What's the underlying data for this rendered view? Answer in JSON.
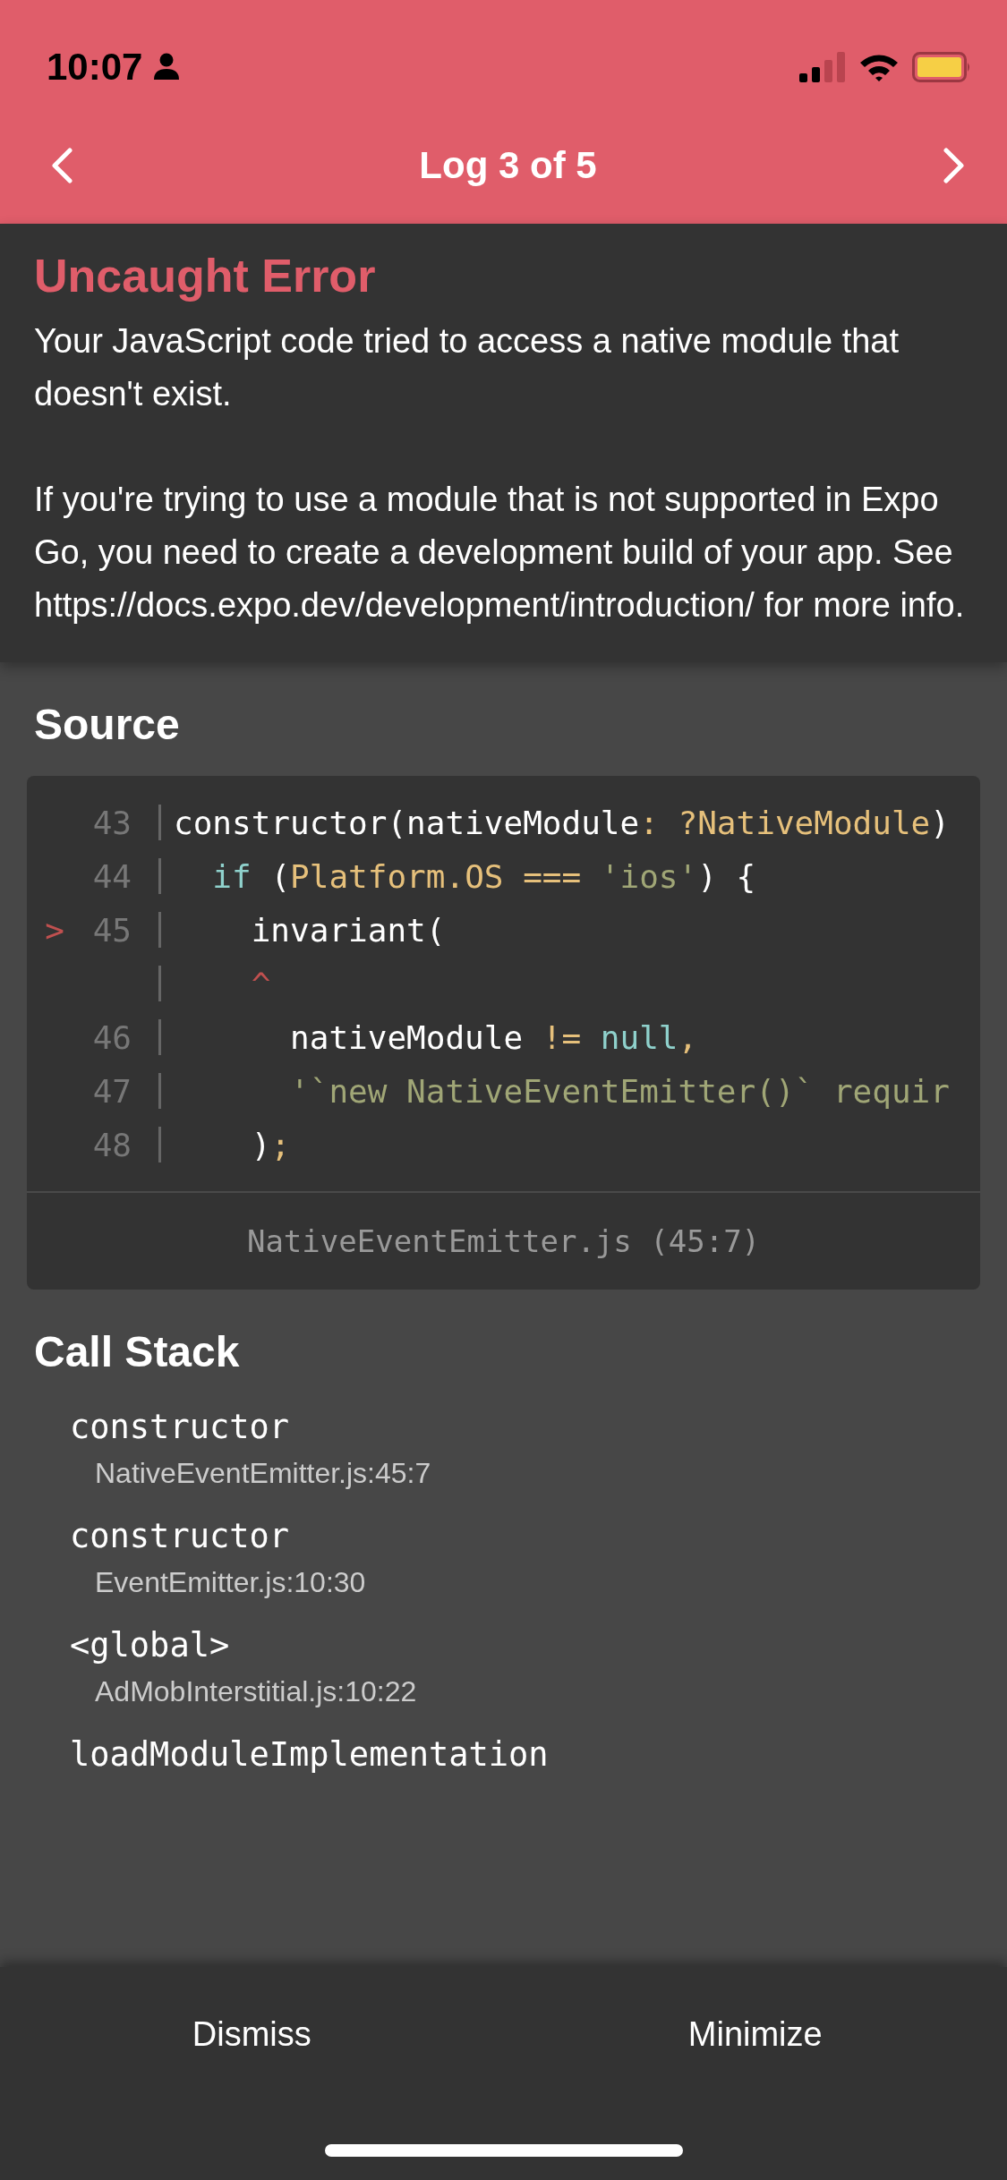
{
  "status_bar": {
    "time": "10:07"
  },
  "header": {
    "title": "Log 3 of 5"
  },
  "error": {
    "title": "Uncaught Error",
    "paragraphs": [
      "Your JavaScript code tried to access a native module that doesn't exist.",
      "If you're trying to use a module that is not supported in Expo Go, you need to create a development build of your app. See https://docs.expo.dev/development/introduction/ for more info."
    ]
  },
  "source": {
    "title": "Source",
    "lines": [
      {
        "number": "43",
        "tokens": [
          {
            "text": "constructor(nativeModule",
            "kind": "plain"
          },
          {
            "text": ": ?NativeModule",
            "kind": "type"
          },
          {
            "text": ")",
            "kind": "plain"
          }
        ]
      },
      {
        "number": "44",
        "tokens": [
          {
            "text": "  if",
            "kind": "keyword"
          },
          {
            "text": " (",
            "kind": "plain"
          },
          {
            "text": "Platform.OS === ",
            "kind": "type"
          },
          {
            "text": "'ios'",
            "kind": "string"
          },
          {
            "text": ") {",
            "kind": "plain"
          }
        ]
      },
      {
        "number": "45",
        "marker": ">",
        "tokens": [
          {
            "text": "    invariant(",
            "kind": "plain"
          }
        ]
      },
      {
        "tokens": [
          {
            "text": "    ^",
            "kind": "caret"
          }
        ]
      },
      {
        "number": "46",
        "tokens": [
          {
            "text": "      nativeModule ",
            "kind": "plain"
          },
          {
            "text": "!=",
            "kind": "type"
          },
          {
            "text": " null",
            "kind": "keyword"
          },
          {
            "text": ",",
            "kind": "type"
          }
        ]
      },
      {
        "number": "47",
        "tokens": [
          {
            "text": "      '`new NativeEventEmitter()` requir",
            "kind": "string"
          }
        ]
      },
      {
        "number": "48",
        "tokens": [
          {
            "text": "    )",
            "kind": "plain"
          },
          {
            "text": ";",
            "kind": "type"
          }
        ]
      }
    ],
    "file": "NativeEventEmitter.js (45:7)"
  },
  "call_stack": {
    "title": "Call Stack",
    "frames": [
      {
        "function": "constructor",
        "file": "NativeEventEmitter.js:45:7"
      },
      {
        "function": "constructor",
        "file": "EventEmitter.js:10:30"
      },
      {
        "function": "<global>",
        "file": "AdMobInterstitial.js:10:22"
      },
      {
        "function": "loadModuleImplementation"
      }
    ]
  },
  "buttons": [
    "Dismiss",
    "Minimize"
  ]
}
